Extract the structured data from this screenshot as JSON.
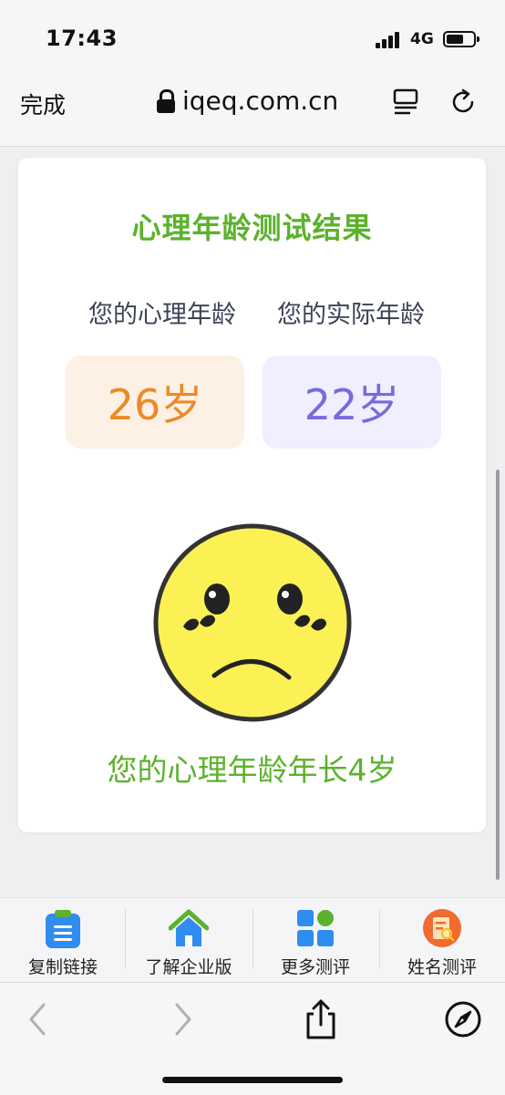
{
  "status_bar": {
    "time": "17:43",
    "network": "4G"
  },
  "browser": {
    "done_label": "完成",
    "url": "iqeq.com.cn"
  },
  "result": {
    "title": "心理年龄测试结果",
    "psych_age_label": "您的心理年龄",
    "actual_age_label": "您的实际年龄",
    "psych_age_value": "26岁",
    "actual_age_value": "22岁",
    "summary": "您的心理年龄年长4岁"
  },
  "toolbar": {
    "items": [
      {
        "label": "复制链接",
        "icon": "clipboard-icon"
      },
      {
        "label": "了解企业版",
        "icon": "home-icon"
      },
      {
        "label": "更多测评",
        "icon": "grid-icon"
      },
      {
        "label": "姓名测评",
        "icon": "name-test-icon"
      }
    ]
  },
  "colors": {
    "accent_green": "#5bb22c",
    "orange": "#ec8a28",
    "purple": "#7a6ad9"
  }
}
